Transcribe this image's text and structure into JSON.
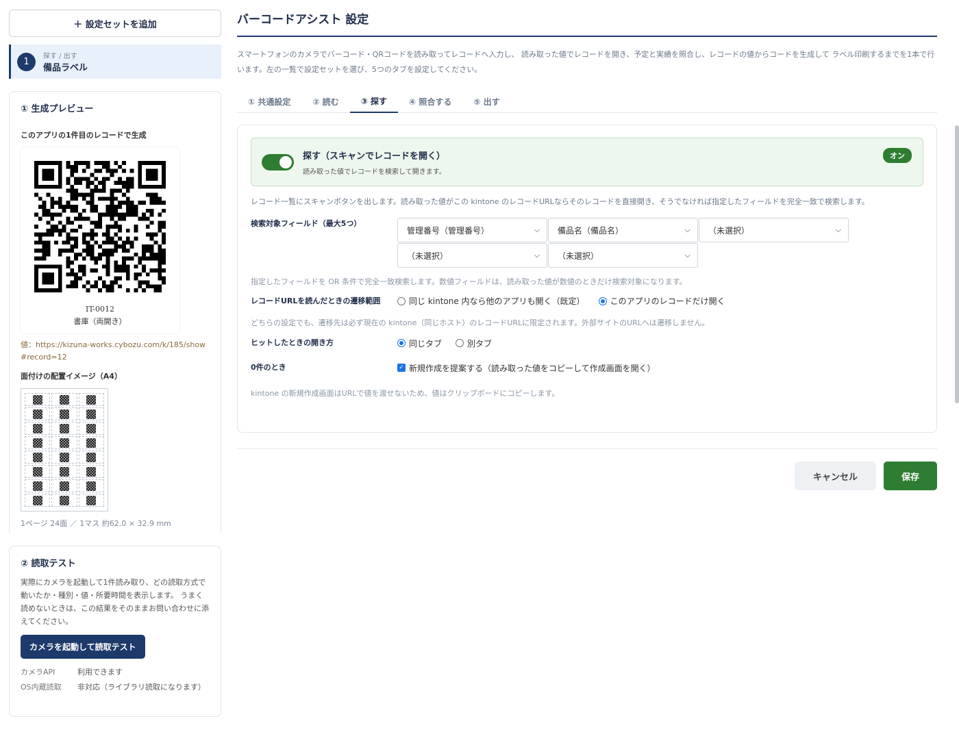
{
  "sidebar": {
    "add_set_label": "＋ 設定セットを追加",
    "set": {
      "number": "1",
      "sub": "探す / 出す",
      "name": "備品ラベル"
    },
    "preview": {
      "title": "① 生成プレビュー",
      "source_label": "このアプリの1件目のレコードで生成",
      "code": "IT-0012",
      "item_name": "書庫（両開き）",
      "value_line": "値：https://kizuna-works.cybozu.com/k/185/show#record=12",
      "layout_label": "面付けの配置イメージ（A4）",
      "sheet_info": "1ページ 24面 ／ 1マス 約62.0 × 32.9 mm"
    },
    "test": {
      "title": "② 読取テスト",
      "desc": "実際にカメラを起動して1件読み取り、どの読取方式で動いたか・種別・値・所要時間を表示します。 うまく読めないときは、この結果をそのままお問い合わせに添えてください。",
      "button_label": "カメラを起動して読取テスト",
      "rows": [
        {
          "key": "カメラAPI",
          "value": "利用できます"
        },
        {
          "key": "OS内蔵読取",
          "value": "非対応（ライブラリ読取になります）"
        }
      ]
    }
  },
  "main": {
    "title": "バーコードアシスト 設定",
    "desc": "スマートフォンのカメラでバーコード・QRコードを読み取ってレコードへ入力し、 読み取った値でレコードを開き、予定と実績を照合し、レコードの値からコードを生成して ラベル印刷するまでを1本で行います。左の一覧で設定セットを選び、5つのタブを設定してください。",
    "tabs": [
      "① 共通設定",
      "② 読む",
      "③ 探す",
      "④ 照合する",
      "⑤ 出す"
    ],
    "active_tab": 2,
    "feature": {
      "title": "探す（スキャンでレコードを開く）",
      "sub": "読み取った値でレコードを検索して開きます。",
      "badge": "オン",
      "enabled": true
    },
    "panel_desc": "レコード一覧にスキャンボタンを出します。読み取った値がこの kintone のレコードURLならそのレコードを直接開き、そうでなければ指定したフィールドを完全一致で検索します。",
    "search_fields": {
      "label": "検索対象フィールド（最大5つ）",
      "selects": [
        "管理番号（管理番号）",
        "備品名（備品名）",
        "（未選択）",
        "（未選択）",
        "（未選択）"
      ],
      "hint": "指定したフィールドを OR 条件で完全一致検索します。数値フィールドは、読み取った値が数値のときだけ検索対象になります。"
    },
    "url_scope": {
      "label": "レコードURLを読んだときの遷移範囲",
      "options": [
        "同じ kintone 内なら他のアプリも開く（既定）",
        "このアプリのレコードだけ開く"
      ],
      "selected": 1,
      "hint": "どちらの設定でも、遷移先は必ず現在の kintone（同じホスト）のレコードURLに限定されます。外部サイトのURLへは遷移しません。"
    },
    "open_mode": {
      "label": "ヒットしたときの開き方",
      "options": [
        "同じタブ",
        "別タブ"
      ],
      "selected": 0
    },
    "zero_hit": {
      "label": "0件のとき",
      "checkbox_label": "新規作成を提案する（読み取った値をコピーして作成画面を開く）",
      "checked": true,
      "hint": "kintone の新規作成画面はURLで値を渡せないため、値はクリップボードにコピーします。"
    },
    "cancel_label": "キャンセル",
    "save_label": "保存"
  },
  "colors": {
    "navy": "#1e3a6b",
    "green": "#2e7d32",
    "radio_blue": "#1a73e8"
  }
}
